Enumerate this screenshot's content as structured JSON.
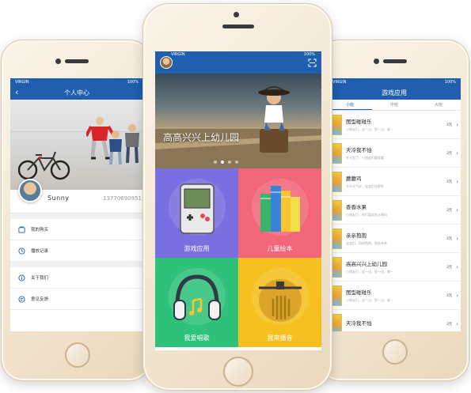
{
  "left": {
    "carrier": "VIRGIN",
    "battery": "100%",
    "title": "个人中心",
    "back": "‹",
    "username": "Sunny",
    "phone_no": "13770690951",
    "menu": [
      {
        "label": "我的购买",
        "icon": "cart-icon"
      },
      {
        "label": "播放记录",
        "icon": "clock-icon"
      },
      {
        "label": "关于我们",
        "icon": "info-icon"
      },
      {
        "label": "意见反馈",
        "icon": "feedback-icon"
      }
    ]
  },
  "center": {
    "carrier": "VIRGIN",
    "battery": "100%",
    "banner_title": "高高兴兴上幼儿园",
    "banner_page": 2,
    "banner_pages": 4,
    "tiles": [
      {
        "label": "游戏应用",
        "color": "#7a6fe0",
        "icon": "gameboy-icon"
      },
      {
        "label": "儿童绘本",
        "color": "#f2667a",
        "icon": "books-icon"
      },
      {
        "label": "我爱唱歌",
        "color": "#2fc27a",
        "icon": "headphones-icon"
      },
      {
        "label": "我来播音",
        "color": "#f6c020",
        "icon": "radio-icon"
      }
    ]
  },
  "right": {
    "carrier": "VIRGIN",
    "battery": "100%",
    "title": "游戏应用",
    "tabs": [
      "小班",
      "中班",
      "大班"
    ],
    "active_tab": 0,
    "items": [
      {
        "title": "图型碰碰乐",
        "desc": "小朋友们，这一边，那一边，哪一",
        "price": "3元"
      },
      {
        "title": "天冷我不怕",
        "desc": "冬天到了，小朋友们要保暖",
        "price": "3元"
      },
      {
        "title": "蘑蘑鸡",
        "desc": "今天天气好，宝宝们去野外",
        "price": "3元"
      },
      {
        "title": "香香水果",
        "desc": "小朋友们，你们喜欢吃水果吗",
        "price": "3元"
      },
      {
        "title": "亲亲抱抱",
        "desc": "宝宝们，妈妈抱抱，爸爸亲亲",
        "price": "3元"
      },
      {
        "title": "高高兴兴上幼儿园",
        "desc": "小朋友们，这一边，那一边，哪一",
        "price": "3元"
      },
      {
        "title": "图型碰碰乐",
        "desc": "小朋友们，这一边，那一边，哪一",
        "price": "3元"
      },
      {
        "title": "天冷我不怕",
        "desc": "",
        "price": "3元"
      }
    ]
  },
  "colors": {
    "brand_blue": "#1f5fae",
    "shell": "#f1e4cf"
  }
}
